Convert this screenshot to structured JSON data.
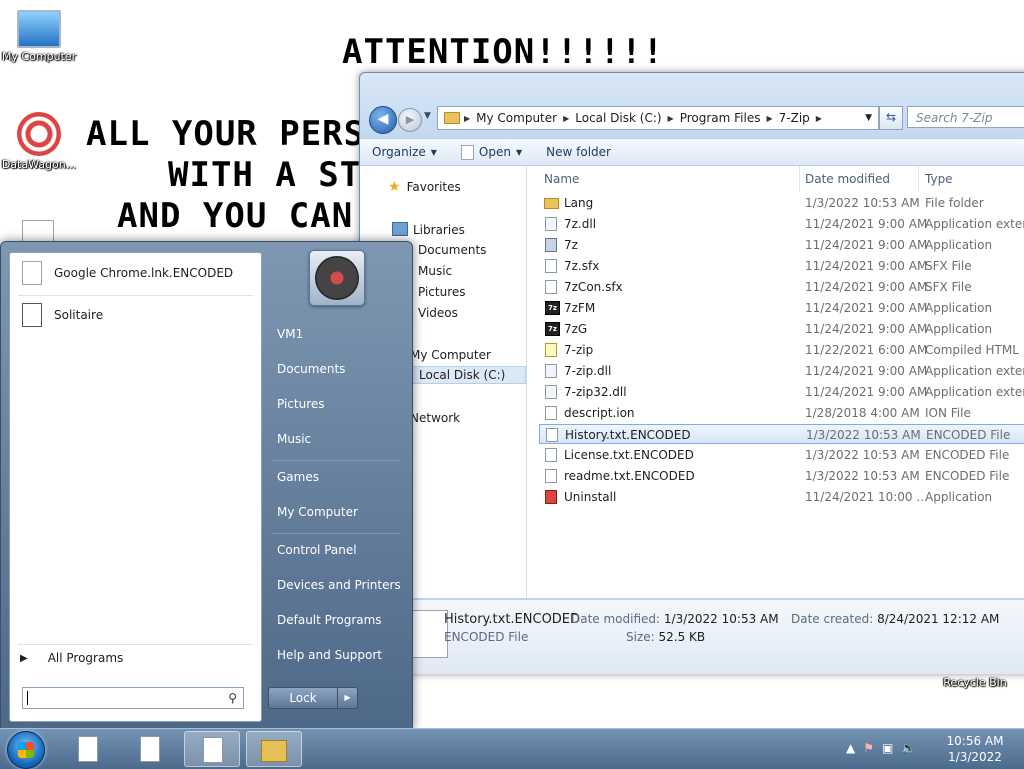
{
  "desktop": {
    "icons": [
      {
        "label": "My Computer"
      },
      {
        "label": "DataWagon..."
      },
      {
        "label": "Recycle Bin"
      }
    ],
    "ransom": {
      "title": "ATTENTION!!!!!!",
      "line1": "ALL YOUR PERS",
      "line2": "WITH A STR",
      "line3": "AND YOU CAN"
    }
  },
  "explorer": {
    "breadcrumb": [
      "My Computer",
      "Local Disk (C:)",
      "Program Files",
      "7-Zip"
    ],
    "search_placeholder": "Search 7-Zip",
    "commands": {
      "organize": "Organize",
      "open": "Open",
      "new_folder": "New folder"
    },
    "nav": {
      "favorites": "Favorites",
      "libraries": "Libraries",
      "documents": "Documents",
      "music": "Music",
      "pictures": "Pictures",
      "videos": "Videos",
      "my_computer": "My Computer",
      "local_disk": "Local Disk (C:)",
      "network": "Network"
    },
    "columns": {
      "name": "Name",
      "date": "Date modified",
      "type": "Type"
    },
    "files": [
      {
        "name": "Lang",
        "date": "1/3/2022 10:53 AM",
        "type": "File folder",
        "icon": "folder"
      },
      {
        "name": "7z.dll",
        "date": "11/24/2021 9:00 AM",
        "type": "Application extens...",
        "icon": "dll"
      },
      {
        "name": "7z",
        "date": "11/24/2021 9:00 AM",
        "type": "Application",
        "icon": "app"
      },
      {
        "name": "7z.sfx",
        "date": "11/24/2021 9:00 AM",
        "type": "SFX File",
        "icon": "file"
      },
      {
        "name": "7zCon.sfx",
        "date": "11/24/2021 9:00 AM",
        "type": "SFX File",
        "icon": "file"
      },
      {
        "name": "7zFM",
        "date": "11/24/2021 9:00 AM",
        "type": "Application",
        "icon": "sz"
      },
      {
        "name": "7zG",
        "date": "11/24/2021 9:00 AM",
        "type": "Application",
        "icon": "sz"
      },
      {
        "name": "7-zip",
        "date": "11/22/2021 6:00 AM",
        "type": "Compiled HTML ...",
        "icon": "help"
      },
      {
        "name": "7-zip.dll",
        "date": "11/24/2021 9:00 AM",
        "type": "Application extens...",
        "icon": "dll"
      },
      {
        "name": "7-zip32.dll",
        "date": "11/24/2021 9:00 AM",
        "type": "Application extens...",
        "icon": "dll"
      },
      {
        "name": "descript.ion",
        "date": "1/28/2018 4:00 AM",
        "type": "ION File",
        "icon": "file"
      },
      {
        "name": "History.txt.ENCODED",
        "date": "1/3/2022 10:53 AM",
        "type": "ENCODED File",
        "icon": "file"
      },
      {
        "name": "License.txt.ENCODED",
        "date": "1/3/2022 10:53 AM",
        "type": "ENCODED File",
        "icon": "file"
      },
      {
        "name": "readme.txt.ENCODED",
        "date": "1/3/2022 10:53 AM",
        "type": "ENCODED File",
        "icon": "file"
      },
      {
        "name": "Uninstall",
        "date": "11/24/2021 10:00 ...",
        "type": "Application",
        "icon": "un"
      }
    ],
    "selected_index": 11,
    "details": {
      "name": "History.txt.ENCODED",
      "kind": "ENCODED File",
      "modified_label": "Date modified:",
      "modified_value": "1/3/2022 10:53 AM",
      "created_label": "Date created:",
      "created_value": "8/24/2021 12:12 AM",
      "size_label": "Size:",
      "size_value": "52.5 KB"
    }
  },
  "startmenu": {
    "pinned": [
      {
        "label": "Google Chrome.lnk.ENCODED"
      },
      {
        "label": "Solitaire"
      }
    ],
    "all_programs": "All Programs",
    "right_links": [
      "VM1",
      "Documents",
      "Pictures",
      "Music",
      "Games",
      "My Computer",
      "Control Panel",
      "Devices and Printers",
      "Default Programs",
      "Help and Support"
    ],
    "lock_label": "Lock"
  },
  "taskbar": {
    "time": "10:56 AM",
    "date": "1/3/2022"
  }
}
